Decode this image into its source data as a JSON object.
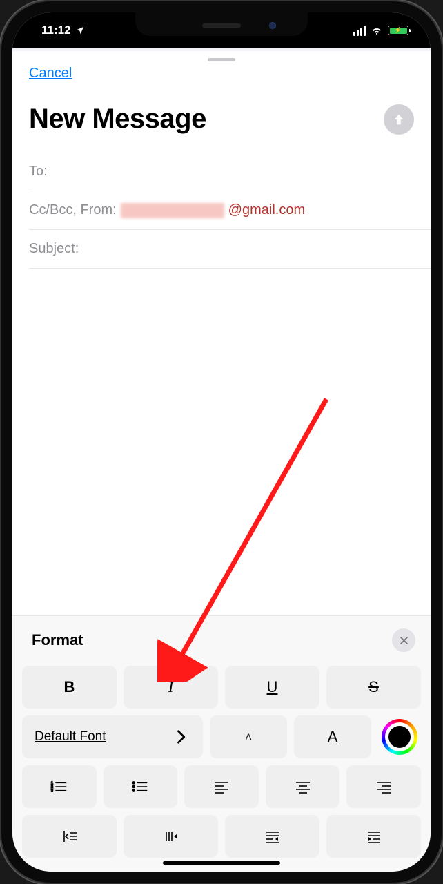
{
  "status": {
    "time": "11:12"
  },
  "nav": {
    "cancel": "Cancel"
  },
  "compose": {
    "title": "New Message",
    "fields": {
      "to_label": "To:",
      "ccbcc_label": "Cc/Bcc, From:",
      "from_suffix": "@gmail.com",
      "subject_label": "Subject:"
    }
  },
  "format": {
    "title": "Format",
    "font_button": "Default Font",
    "bold": "B",
    "italic": "I",
    "underline": "U",
    "strike": "S",
    "size_small": "A",
    "size_big": "A"
  }
}
